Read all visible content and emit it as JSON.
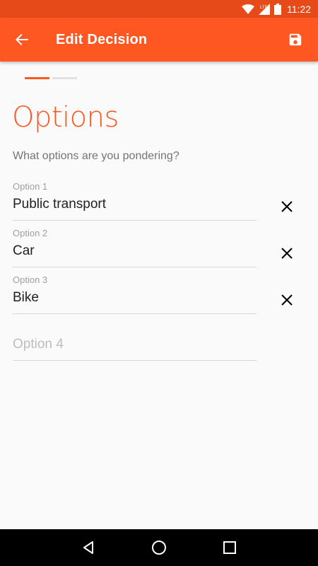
{
  "status_bar": {
    "time": "11:22",
    "network": "LTE",
    "icons": [
      "wifi-icon",
      "signal-icon",
      "battery-icon"
    ]
  },
  "app_bar": {
    "title": "Edit Decision",
    "back_icon": "arrow-back-icon",
    "save_icon": "save-icon",
    "color": "#ff5722"
  },
  "stepper": {
    "total_steps": 2,
    "current_step": 1
  },
  "section": {
    "title": "Options",
    "prompt": "What options are you pondering?"
  },
  "options": [
    {
      "label": "Option 1",
      "value": "Public transport"
    },
    {
      "label": "Option 2",
      "value": "Car"
    },
    {
      "label": "Option 3",
      "value": "Bike"
    }
  ],
  "new_option": {
    "placeholder": "Option 4"
  },
  "nav_bar": {
    "icons": [
      "back-triangle-icon",
      "home-circle-icon",
      "recents-square-icon"
    ]
  }
}
